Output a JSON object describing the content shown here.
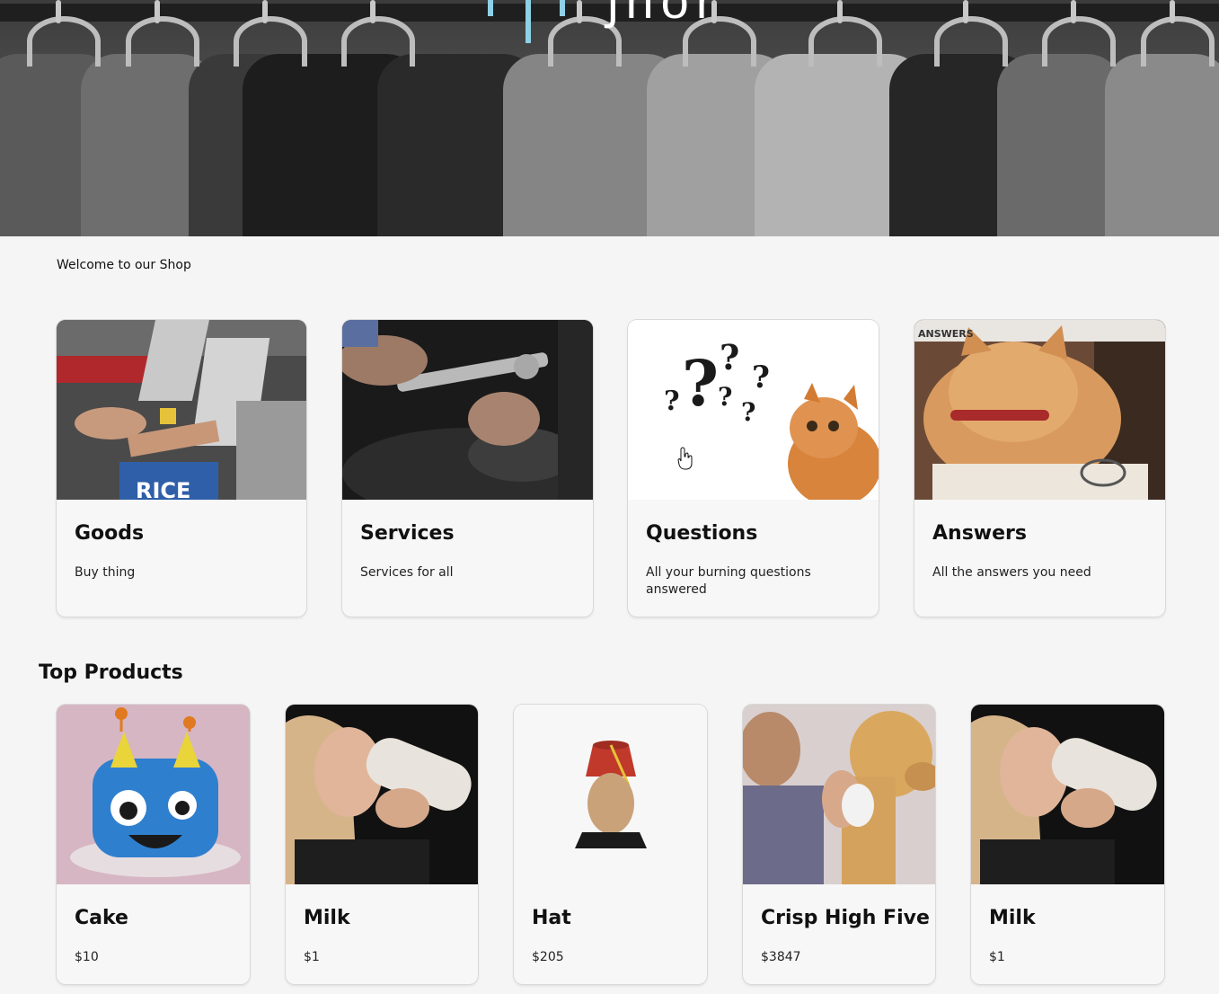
{
  "hero": {
    "title_fragment": "ʃhor"
  },
  "welcome": {
    "text": "Welcome to our Shop"
  },
  "categories": [
    {
      "title": "Goods",
      "description": "Buy thing",
      "image": "checkout-counter-photo"
    },
    {
      "title": "Services",
      "description": "Services for all",
      "image": "mechanic-wrench-photo"
    },
    {
      "title": "Questions",
      "description": "All your burning questions answered",
      "image": "question-marks-cat-photo"
    },
    {
      "title": "Answers",
      "description": "All the answers you need",
      "image": "cat-with-book-photo",
      "image_caption": "ANSWERS"
    }
  ],
  "top_products": {
    "heading": "Top Products",
    "items": [
      {
        "name": "Cake",
        "price": "$10",
        "image": "monster-cake-photo"
      },
      {
        "name": "Milk",
        "price": "$1",
        "image": "woman-drinking-milk-photo"
      },
      {
        "name": "Hat",
        "price": "$205",
        "image": "fez-hat-mannequin-photo"
      },
      {
        "name": "Crisp High Five",
        "price": "$3847",
        "image": "man-dog-high-five-photo"
      },
      {
        "name": "Milk",
        "price": "$1",
        "image": "woman-drinking-milk-photo"
      }
    ]
  },
  "colors": {
    "page_background": "#f5f5f5",
    "title_accent": "#8ed0e6"
  },
  "icons": {
    "cursor": "hand-pointer-icon"
  }
}
